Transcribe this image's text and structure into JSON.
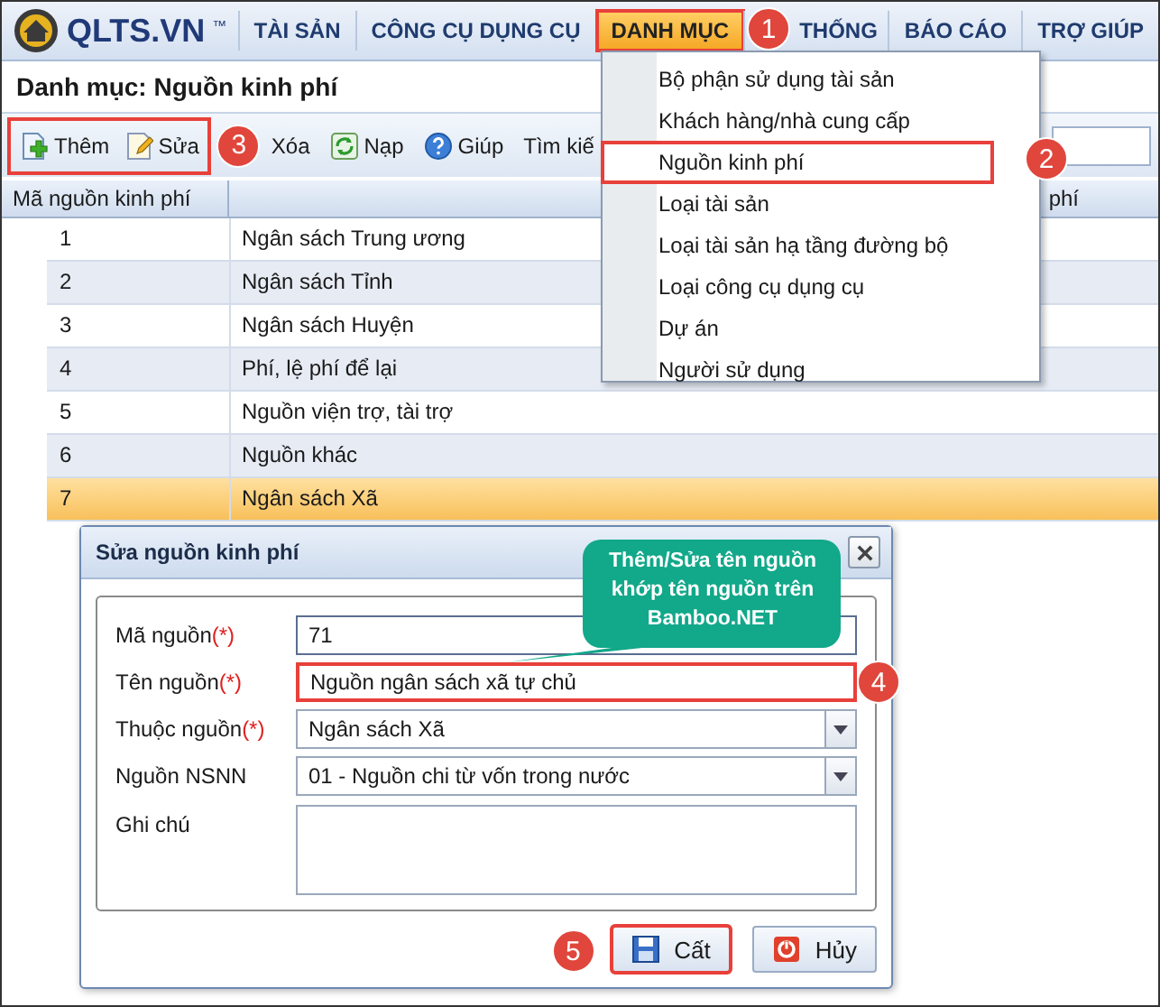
{
  "logo": {
    "text": "QLTS.VN",
    "mark": "™"
  },
  "nav": [
    {
      "label": "TÀI SẢN",
      "selected": false
    },
    {
      "label": "CÔNG CỤ DỤNG CỤ",
      "selected": false
    },
    {
      "label": "DANH MỤC",
      "selected": true,
      "badge": "1"
    },
    {
      "label": "THỐNG",
      "selected": false
    },
    {
      "label": "BÁO CÁO",
      "selected": false
    },
    {
      "label": "TRỢ GIÚP",
      "selected": false
    }
  ],
  "menu": {
    "items": [
      {
        "label": "Bộ phận sử dụng tài sản",
        "selected": false
      },
      {
        "label": "Khách hàng/nhà cung cấp",
        "selected": false
      },
      {
        "label": "Nguồn kinh phí",
        "selected": true,
        "badge": "2"
      },
      {
        "label": "Loại tài sản",
        "selected": false
      },
      {
        "label": "Loại tài sản hạ tầng đường bộ",
        "selected": false
      },
      {
        "label": "Loại công cụ dụng cụ",
        "selected": false
      },
      {
        "label": "Dự án",
        "selected": false
      },
      {
        "label": "Người sử dụng",
        "selected": false
      }
    ]
  },
  "page_title": "Danh mục: Nguồn kinh phí",
  "toolbar": {
    "groups": [
      {
        "highlighted": true,
        "badge": "3",
        "buttons": [
          {
            "label": "Thêm"
          },
          {
            "label": "Sửa"
          }
        ]
      },
      {
        "highlighted": false,
        "buttons": [
          {
            "label": "Xóa"
          },
          {
            "label": "Nạp"
          },
          {
            "label": "Giúp"
          }
        ]
      }
    ],
    "search_label": "Tìm kiế"
  },
  "table": {
    "columns": [
      "Mã nguồn kinh phí",
      "phí"
    ],
    "rows": [
      {
        "code": "1",
        "name": "Ngân sách Trung ương",
        "selected": false
      },
      {
        "code": "2",
        "name": "Ngân sách Tỉnh",
        "selected": false
      },
      {
        "code": "3",
        "name": "Ngân sách Huyện",
        "selected": false
      },
      {
        "code": "4",
        "name": "Phí, lệ phí để lại",
        "selected": false
      },
      {
        "code": "5",
        "name": "Nguồn viện trợ, tài trợ",
        "selected": false
      },
      {
        "code": "6",
        "name": "Nguồn khác",
        "selected": false
      },
      {
        "code": "7",
        "name": "Ngân sách Xã",
        "selected": true
      }
    ]
  },
  "dialog": {
    "title": "Sửa nguồn kinh phí",
    "fields": [
      {
        "label": "Mã nguồn",
        "required": "(*)",
        "kind": "text",
        "value": "71",
        "highlighted": false
      },
      {
        "label": "Tên nguồn",
        "required": "(*)",
        "kind": "text",
        "value": "Nguồn ngân sách xã tự chủ",
        "highlighted": true,
        "badge": "4"
      },
      {
        "label": "Thuộc nguồn",
        "required": "(*)",
        "kind": "select",
        "value": "Ngân sách Xã",
        "highlighted": false
      },
      {
        "label": "Nguồn NSNN",
        "kind": "select",
        "value": "01 - Nguồn chi từ vốn trong nước",
        "highlighted": false
      },
      {
        "label": "Ghi chú",
        "kind": "textarea",
        "highlighted": false
      }
    ],
    "buttons": [
      {
        "label": "Cất",
        "highlighted": true,
        "badge": "5"
      },
      {
        "label": "Hủy",
        "highlighted": false
      }
    ]
  },
  "callout": {
    "text": "Thêm/Sửa tên nguồn khớp tên nguồn trên Bamboo.NET"
  }
}
